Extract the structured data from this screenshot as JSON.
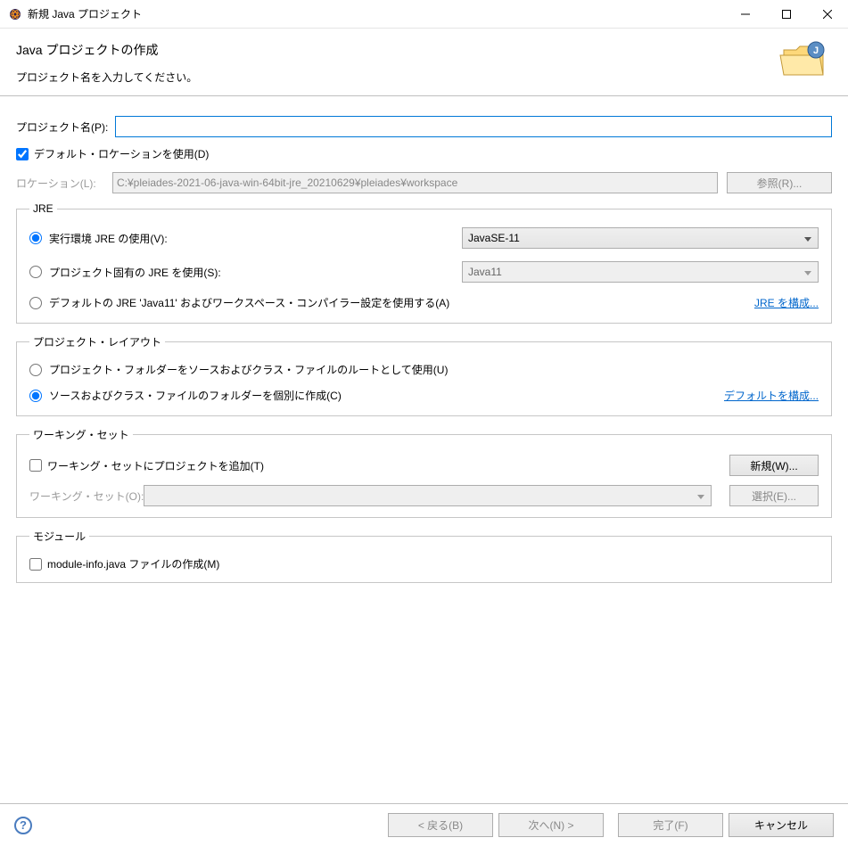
{
  "titlebar": {
    "title": "新規 Java プロジェクト"
  },
  "header": {
    "title": "Java プロジェクトの作成",
    "subtitle": "プロジェクト名を入力してください。"
  },
  "project": {
    "name_label": "プロジェクト名(P):",
    "name_value": "",
    "use_default_label": "デフォルト・ロケーションを使用(D)",
    "location_label": "ロケーション(L):",
    "location_value": "C:¥pleiades-2021-06-java-win-64bit-jre_20210629¥pleiades¥workspace",
    "browse_label": "参照(R)..."
  },
  "jre": {
    "legend": "JRE",
    "opt_env_label": "実行環境 JRE の使用(V):",
    "env_select": "JavaSE-11",
    "opt_proj_label": "プロジェクト固有の JRE を使用(S):",
    "proj_select": "Java11",
    "opt_default_label": "デフォルトの JRE 'Java11' およびワークスペース・コンパイラー設定を使用する(A)",
    "configure_link": "JRE を構成..."
  },
  "layout": {
    "legend": "プロジェクト・レイアウト",
    "opt_root_label": "プロジェクト・フォルダーをソースおよびクラス・ファイルのルートとして使用(U)",
    "opt_sep_label": "ソースおよびクラス・ファイルのフォルダーを個別に作成(C)",
    "configure_link": "デフォルトを構成..."
  },
  "workingset": {
    "legend": "ワーキング・セット",
    "add_label": "ワーキング・セットにプロジェクトを追加(T)",
    "ws_label": "ワーキング・セット(O):",
    "new_label": "新規(W)...",
    "select_label": "選択(E)..."
  },
  "module": {
    "legend": "モジュール",
    "create_label": "module-info.java ファイルの作成(M)"
  },
  "footer": {
    "back_label": "< 戻る(B)",
    "next_label": "次へ(N) >",
    "finish_label": "完了(F)",
    "cancel_label": "キャンセル"
  }
}
